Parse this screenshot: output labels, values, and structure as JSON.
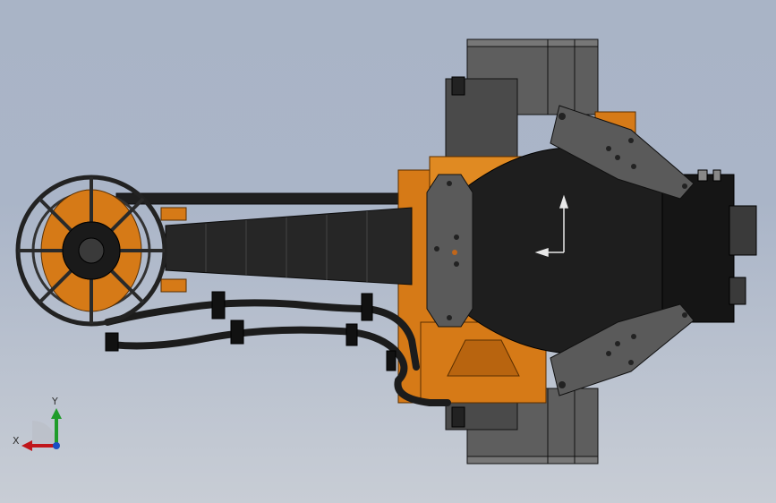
{
  "viewport": {
    "background_top": "#a9b4c6",
    "background_bottom": "#c8cdd5"
  },
  "colors": {
    "orange_body": "#d67a17",
    "dark_shell": "#2b2b2b",
    "grey_plate": "#5a5a5a",
    "motor_grey": "#6b6b6b",
    "cable_black": "#1c1c1c"
  },
  "triad": {
    "x_label": "X",
    "y_label": "Y",
    "x_color": "#c0161b",
    "y_color": "#1f9c2a",
    "z_color": "#1a4fc4"
  }
}
